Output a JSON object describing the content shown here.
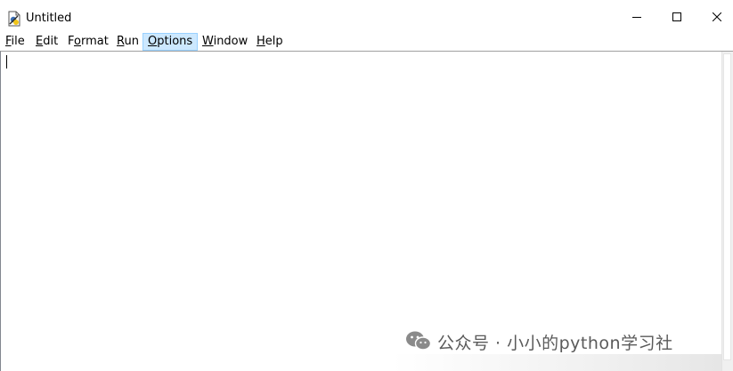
{
  "window": {
    "title": "Untitled",
    "icon": "idle-file-icon",
    "controls": [
      "minimize-icon",
      "maximize-icon",
      "close-icon"
    ]
  },
  "menu": {
    "file": {
      "mnemonic": "F",
      "rest": "ile"
    },
    "edit": {
      "mnemonic": "E",
      "rest": "dit"
    },
    "format": {
      "pre": "F",
      "mnemonic": "o",
      "rest": "rmat"
    },
    "run": {
      "mnemonic": "R",
      "rest": "un"
    },
    "options": {
      "mnemonic": "O",
      "rest": "ptions"
    },
    "window": {
      "mnemonic": "W",
      "rest": "indow"
    },
    "help": {
      "mnemonic": "H",
      "rest": "elp"
    },
    "active_item": "Options"
  },
  "editor": {
    "content": ""
  },
  "watermark": {
    "icon": "wechat-icon",
    "text": "公众号 · 小小的python学习社"
  },
  "colors": {
    "menu_highlight": "#cce8ff",
    "menu_highlight_border": "#99d1ff"
  }
}
